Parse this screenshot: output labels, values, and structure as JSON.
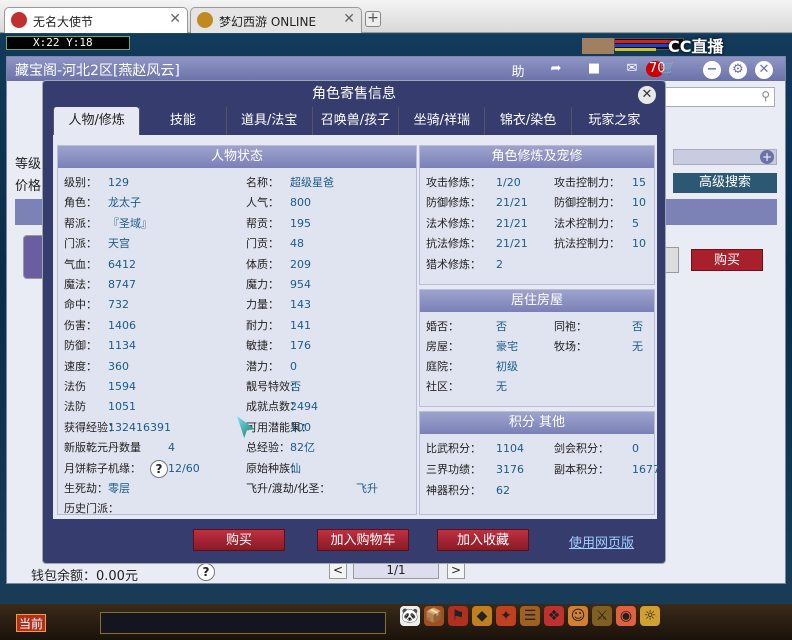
{
  "browser": {
    "tabs": [
      {
        "title": "无名大使节",
        "color": "#c03030"
      },
      {
        "title": "梦幻西游 ONLINE",
        "color": "#c08a20"
      }
    ]
  },
  "game": {
    "coords": "X:22 Y:18",
    "cc_logo": "CC直播",
    "mail_badge": "70",
    "bottom_button": "当前"
  },
  "shop": {
    "title": "藏宝阁-河北2区[燕赵风云]",
    "assist_label": "助",
    "level_label": "等级",
    "price_label": "价格",
    "advanced_search": "高级搜索",
    "buy_label": "购买",
    "wallet_label": "钱包余额：0.00元",
    "help_q": "?",
    "page": "1/1",
    "prev": "<",
    "next": ">"
  },
  "dialog": {
    "title": "角色寄售信息",
    "close": "✕",
    "tabs": [
      "人物/修炼",
      "技能",
      "道具/法宝",
      "召唤兽/孩子",
      "坐骑/祥瑞",
      "锦衣/染色",
      "玩家之家"
    ],
    "status": {
      "header": "人物状态",
      "left": [
        [
          "级别：",
          "129"
        ],
        [
          "角色：",
          "龙太子"
        ],
        [
          "帮派：",
          "『圣域』"
        ],
        [
          "门派：",
          "天宫"
        ],
        [
          "气血：",
          "6412"
        ],
        [
          "魔法：",
          "8747"
        ],
        [
          "命中：",
          "732"
        ],
        [
          "伤害：",
          "1406"
        ],
        [
          "防御：",
          "1134"
        ],
        [
          "速度：",
          "360"
        ],
        [
          "法伤",
          "1594"
        ],
        [
          "法防",
          "1051"
        ],
        [
          "获得经验：",
          "132416391"
        ],
        [
          "新版乾元丹数量",
          "4"
        ],
        [
          "月饼粽子机缘：",
          "12/60"
        ],
        [
          "生死劫：",
          "零层"
        ],
        [
          "历史门派：",
          ""
        ]
      ],
      "right": [
        [
          "名称：",
          "超级星爸"
        ],
        [
          "人气：",
          "800"
        ],
        [
          "帮贡：",
          "195"
        ],
        [
          "门贡：",
          "48"
        ],
        [
          "体质：",
          "209"
        ],
        [
          "魔力：",
          "954"
        ],
        [
          "力量：",
          "143"
        ],
        [
          "耐力：",
          "141"
        ],
        [
          "敏捷：",
          "176"
        ],
        [
          "潜力：",
          "0"
        ],
        [
          "靓号特效：",
          "否"
        ],
        [
          "成就点数：",
          "2494"
        ],
        [
          "可用潜能果：",
          "100"
        ],
        [
          "总经验：",
          "82亿"
        ],
        [
          "原始种族：",
          "仙"
        ],
        [
          "飞升/渡劫/化圣：",
          "飞升"
        ]
      ]
    },
    "cultivation": {
      "header": "角色修炼及宠修",
      "rows": [
        [
          "攻击修炼：",
          "1/20",
          "攻击控制力：",
          "15"
        ],
        [
          "防御修炼：",
          "21/21",
          "防御控制力：",
          "10"
        ],
        [
          "法术修炼：",
          "21/21",
          "法术控制力：",
          "5"
        ],
        [
          "抗法修炼：",
          "21/21",
          "抗法控制力：",
          "10"
        ],
        [
          "猎术修炼：",
          "2",
          "",
          ""
        ]
      ]
    },
    "housing": {
      "header": "居住房屋",
      "rows": [
        [
          "婚否：",
          "否",
          "同袍：",
          "否"
        ],
        [
          "房屋：",
          "豪宅",
          "牧场：",
          "无"
        ],
        [
          "庭院：",
          "初级",
          "",
          ""
        ],
        [
          "社区：",
          "无",
          "",
          ""
        ]
      ]
    },
    "points": {
      "header": "积分 其他",
      "rows": [
        [
          "比武积分：",
          "1104",
          "剑会积分：",
          "0"
        ],
        [
          "三界功绩：",
          "3176",
          "副本积分：",
          "1677"
        ],
        [
          "神器积分：",
          "62",
          "",
          ""
        ]
      ]
    },
    "buttons": {
      "buy": "购买",
      "add_cart": "加入购物车",
      "add_fav": "加入收藏",
      "web": "使用网页版"
    }
  }
}
